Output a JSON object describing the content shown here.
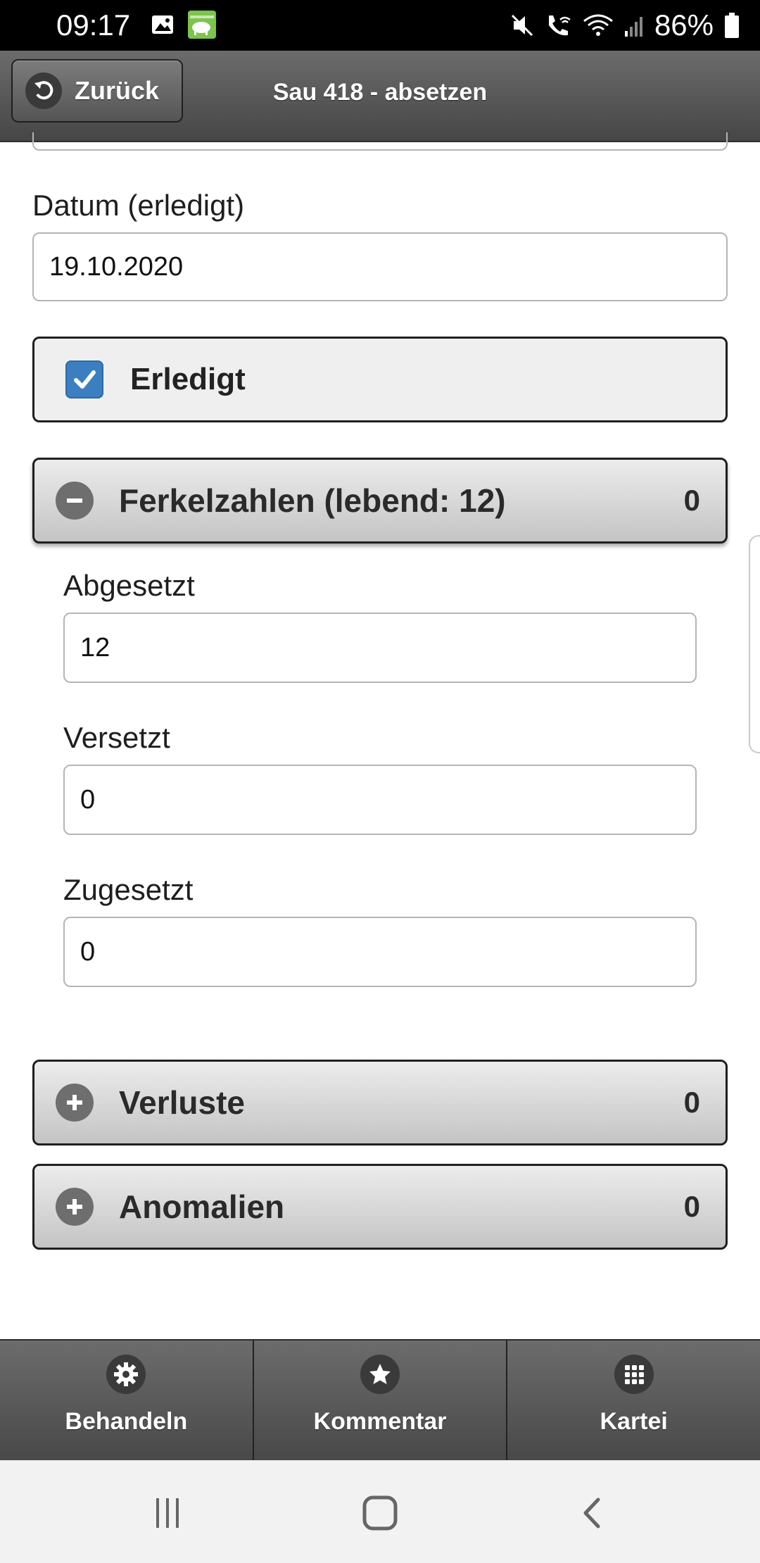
{
  "status_bar": {
    "time": "09:17",
    "battery_percent": "86%",
    "icons": [
      "image-icon",
      "app-pig-icon",
      "mute-icon",
      "wifi-call-icon",
      "wifi-icon",
      "signal-icon",
      "battery-icon"
    ]
  },
  "header": {
    "back_label": "Zurück",
    "title": "Sau 418 - absetzen"
  },
  "form": {
    "date_label": "Datum (erledigt)",
    "date_value": "19.10.2020",
    "done_label": "Erledigt",
    "done_checked": true
  },
  "sections": {
    "ferkelzahlen": {
      "title": "Ferkelzahlen (lebend: 12)",
      "count": "0",
      "expanded": true,
      "fields": {
        "abgesetzt_label": "Abgesetzt",
        "abgesetzt_value": "12",
        "versetzt_label": "Versetzt",
        "versetzt_value": "0",
        "zugesetzt_label": "Zugesetzt",
        "zugesetzt_value": "0"
      }
    },
    "verluste": {
      "title": "Verluste",
      "count": "0",
      "expanded": false
    },
    "anomalien": {
      "title": "Anomalien",
      "count": "0",
      "expanded": false
    }
  },
  "bottom_nav": {
    "behandeln": "Behandeln",
    "kommentar": "Kommentar",
    "kartei": "Kartei"
  },
  "colors": {
    "header": "#555555",
    "checkbox": "#3b7fc0",
    "collapsible": "#d6d6d6"
  }
}
